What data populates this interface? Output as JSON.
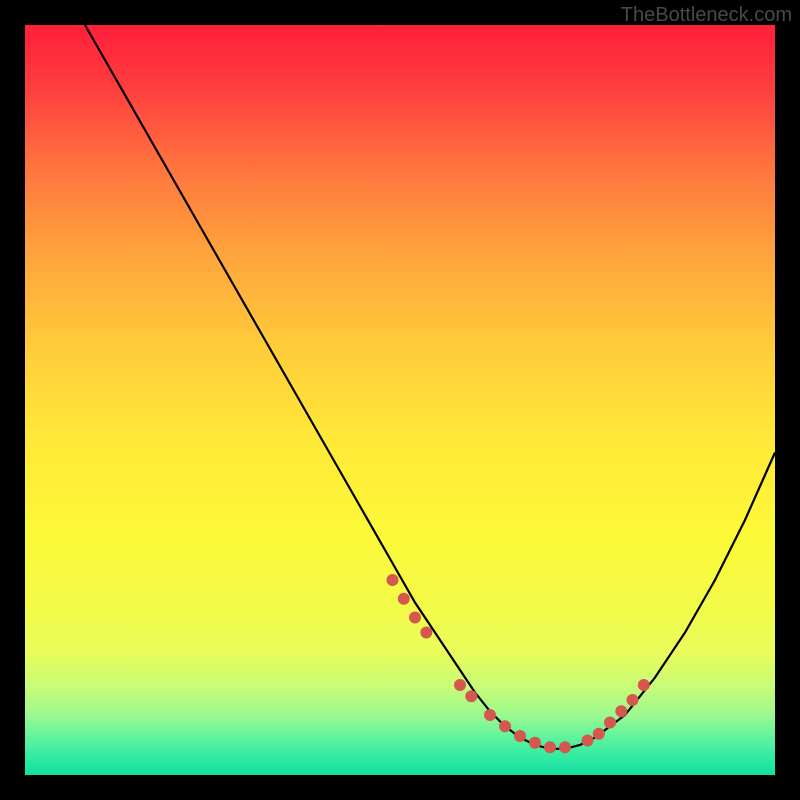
{
  "attribution": "TheBottleneck.com",
  "chart_data": {
    "type": "line",
    "title": "",
    "xlabel": "",
    "ylabel": "",
    "xlim": [
      0,
      100
    ],
    "ylim": [
      0,
      100
    ],
    "series": [
      {
        "name": "curve",
        "x": [
          8,
          12,
          16,
          20,
          24,
          28,
          32,
          36,
          40,
          44,
          48,
          52,
          54,
          56,
          58,
          60,
          62,
          64,
          66,
          68,
          70,
          72,
          74,
          76,
          80,
          84,
          88,
          92,
          96,
          100
        ],
        "y": [
          100,
          93,
          86,
          79,
          72,
          65,
          58,
          51,
          44,
          37,
          30,
          23,
          20,
          17,
          14,
          11,
          8.5,
          6.5,
          5,
          4,
          3.5,
          3.5,
          4,
          5,
          8,
          13,
          19,
          26,
          34,
          43
        ]
      }
    ],
    "markers": {
      "x": [
        49,
        50.5,
        52,
        53.5,
        58,
        59.5,
        62,
        64,
        66,
        68,
        70,
        72,
        75,
        76.5,
        78,
        79.5,
        81,
        82.5
      ],
      "y": [
        26,
        23.5,
        21,
        19,
        12,
        10.5,
        8,
        6.5,
        5.2,
        4.3,
        3.7,
        3.7,
        4.6,
        5.5,
        7,
        8.5,
        10,
        12
      ]
    }
  },
  "colors": {
    "curve": "#000000",
    "marker": "#d5584f"
  }
}
